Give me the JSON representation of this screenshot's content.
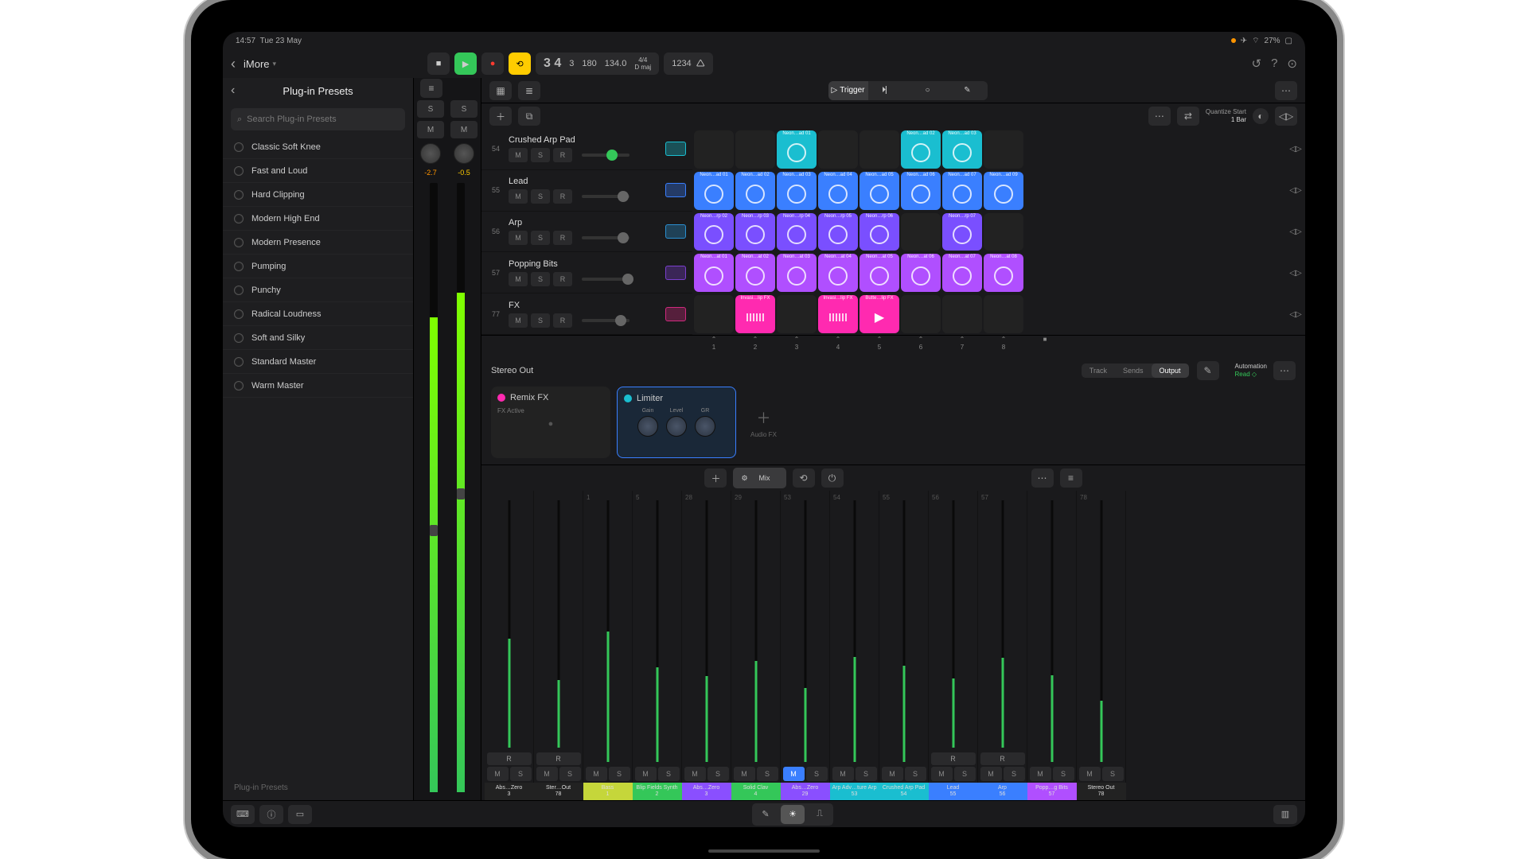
{
  "statusbar": {
    "time": "14:57",
    "date": "Tue 23 May",
    "battery": "27%"
  },
  "project": {
    "name": "iMore"
  },
  "transport": {
    "bars": "3 4",
    "beat": "3",
    "sub": "180",
    "tempo": "134.0",
    "sig_top": "4/4",
    "sig_key": "D maj",
    "counter": "1234"
  },
  "presets": {
    "title": "Plug-in Presets",
    "search_placeholder": "Search Plug-in Presets",
    "footer": "Plug-in Presets",
    "items": [
      "Classic Soft Knee",
      "Fast and Loud",
      "Hard Clipping",
      "Modern High End",
      "Modern Presence",
      "Pumping",
      "Punchy",
      "Radical Loudness",
      "Soft and Silky",
      "Standard Master",
      "Warm Master"
    ]
  },
  "channel": {
    "db_left": "-2.7",
    "db_right": "-0.5"
  },
  "toolbar": {
    "trigger": "Trigger"
  },
  "quantize": {
    "label": "Quantize Start",
    "value": "1 Bar"
  },
  "tracks": [
    {
      "num": "54",
      "name": "Crushed Arp Pad",
      "icon": "#1abed0",
      "slider": "#34c759",
      "spos": 52
    },
    {
      "num": "55",
      "name": "Lead",
      "icon": "#3a7fff",
      "slider": "",
      "spos": 75
    },
    {
      "num": "56",
      "name": "Arp",
      "icon": "#2a8fd0",
      "slider": "",
      "spos": 75
    },
    {
      "num": "57",
      "name": "Popping Bits",
      "icon": "#7a3fcf",
      "slider": "",
      "spos": 85
    },
    {
      "num": "77",
      "name": "FX",
      "icon": "#d02a7f",
      "slider": "",
      "spos": 70
    }
  ],
  "msr": {
    "m": "M",
    "s": "S",
    "r": "R"
  },
  "cells": [
    [
      null,
      null,
      {
        "c": "#1abed0",
        "l": "Neon…ad 01"
      },
      null,
      null,
      {
        "c": "#1abed0",
        "l": "Neon…ad 02"
      },
      {
        "c": "#1abed0",
        "l": "Neon…ad 03"
      },
      null
    ],
    [
      {
        "c": "#3a7fff",
        "l": "Neon…ad 01"
      },
      {
        "c": "#3a7fff",
        "l": "Neon…ad 02"
      },
      {
        "c": "#3a7fff",
        "l": "Neon…ad 03"
      },
      {
        "c": "#3a7fff",
        "l": "Neon…ad 04"
      },
      {
        "c": "#3a7fff",
        "l": "Neon…ad 05"
      },
      {
        "c": "#3a7fff",
        "l": "Neon…ad 06"
      },
      {
        "c": "#3a7fff",
        "l": "Neon…ad 07"
      },
      {
        "c": "#3a7fff",
        "l": "Neon…ad 09"
      }
    ],
    [
      {
        "c": "#7a4fff",
        "l": "Neon…rp 02"
      },
      {
        "c": "#7a4fff",
        "l": "Neon…rp 03"
      },
      {
        "c": "#7a4fff",
        "l": "Neon…rp 04"
      },
      {
        "c": "#7a4fff",
        "l": "Neon…rp 05"
      },
      {
        "c": "#7a4fff",
        "l": "Neon…rp 06"
      },
      null,
      {
        "c": "#7a4fff",
        "l": "Neon…rp 07"
      },
      null
    ],
    [
      {
        "c": "#b04fff",
        "l": "Neon…at 01"
      },
      {
        "c": "#b04fff",
        "l": "Neon…at 02"
      },
      {
        "c": "#b04fff",
        "l": "Neon…at 03"
      },
      {
        "c": "#b04fff",
        "l": "Neon…at 04"
      },
      {
        "c": "#b04fff",
        "l": "Neon…at 05"
      },
      {
        "c": "#b04fff",
        "l": "Neon…at 06"
      },
      {
        "c": "#b04fff",
        "l": "Neon…at 07"
      },
      {
        "c": "#b04fff",
        "l": "Neon…at 08"
      }
    ],
    [
      null,
      {
        "c": "#ff2ab0",
        "l": "Invasi…lip FX",
        "t": "bars"
      },
      null,
      {
        "c": "#ff2ab0",
        "l": "Invasi…lip FX",
        "t": "bars"
      },
      {
        "c": "#ff2ab0",
        "l": "Butte…lip FX",
        "t": "tri"
      },
      null,
      null,
      null
    ]
  ],
  "columns": [
    "1",
    "2",
    "3",
    "4",
    "5",
    "6",
    "7",
    "8"
  ],
  "output": {
    "title": "Stereo Out",
    "tabs": [
      "Track",
      "Sends",
      "Output"
    ],
    "active": 2,
    "auto_label": "Automation",
    "auto_value": "Read",
    "fx": [
      {
        "title": "Remix FX",
        "dot": "#ff2ab0",
        "sub": "FX Active",
        "sel": false
      },
      {
        "title": "Limiter",
        "dot": "#1abed0",
        "knobs": [
          "Gain",
          "Level",
          "GR"
        ],
        "sel": true
      }
    ],
    "addfx": "Audio FX"
  },
  "mixer": {
    "mix_label": "Mix",
    "strips": [
      {
        "name": "Abs…Zero",
        "num": "3",
        "col": "#222",
        "r": 1,
        "m": 0
      },
      {
        "name": "Ster…Out",
        "num": "78",
        "col": "#222",
        "r": 1,
        "m": 0
      },
      {
        "name": "Bass",
        "num": "1",
        "col": "#c5d63a",
        "r": 0,
        "m": 0,
        "sn": "1"
      },
      {
        "name": "Blip Fields Synth",
        "num": "2",
        "col": "#34c759",
        "r": 0,
        "m": 0,
        "sn": "5"
      },
      {
        "name": "Abs…Zero",
        "num": "3",
        "col": "#8a4fff",
        "r": 0,
        "m": 0,
        "sn": "28"
      },
      {
        "name": "Solid Clav",
        "num": "4",
        "col": "#34c759",
        "r": 0,
        "m": 0,
        "sn": "29"
      },
      {
        "name": "Abs…Zero",
        "num": "29",
        "col": "#8a4fff",
        "r": 0,
        "m": 1,
        "sn": "53"
      },
      {
        "name": "Arp Adv…ture Arp",
        "num": "53",
        "col": "#1abed0",
        "r": 0,
        "m": 0,
        "sn": "54"
      },
      {
        "name": "Crushed Arp Pad",
        "num": "54",
        "col": "#1abed0",
        "r": 0,
        "m": 0,
        "sn": "55"
      },
      {
        "name": "Lead",
        "num": "55",
        "col": "#3a7fff",
        "r": 1,
        "m": 0,
        "sn": "56"
      },
      {
        "name": "Arp",
        "num": "56",
        "col": "#3a7fff",
        "r": 1,
        "m": 0,
        "sn": "57"
      },
      {
        "name": "Popp…g Bits",
        "num": "57",
        "col": "#b04fff",
        "r": 0,
        "m": 0,
        "sn": ""
      },
      {
        "name": "Stereo Out",
        "num": "78",
        "col": "#222",
        "r": 0,
        "m": 0,
        "sn": "78"
      }
    ]
  }
}
